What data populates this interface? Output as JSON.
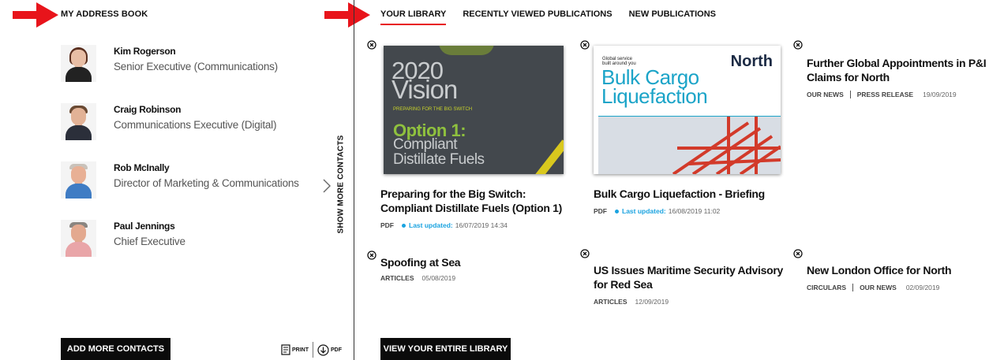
{
  "address_book": {
    "title": "MY ADDRESS BOOK",
    "contacts": [
      {
        "name": "Kim Rogerson",
        "role": "Senior Executive (Communications)"
      },
      {
        "name": "Craig Robinson",
        "role": "Communications Executive (Digital)"
      },
      {
        "name": "Rob McInally",
        "role": "Director of Marketing & Communications"
      },
      {
        "name": "Paul Jennings",
        "role": "Chief Executive"
      }
    ],
    "show_more": "SHOW MORE CONTACTS",
    "add_button": "ADD MORE CONTACTS",
    "print_label": "PRINT",
    "pdf_label": "PDF"
  },
  "library": {
    "tabs": [
      {
        "label": "YOUR LIBRARY",
        "active": true
      },
      {
        "label": "RECENTLY VIEWED PUBLICATIONS",
        "active": false
      },
      {
        "label": "NEW PUBLICATIONS",
        "active": false
      }
    ],
    "items": [
      {
        "title": "Preparing for the Big Switch: Compliant Distillate Fuels (Option 1)",
        "type": "PDF",
        "updated_label": "Last updated:",
        "updated": "16/07/2019 14:34"
      },
      {
        "title": "Bulk Cargo Liquefaction - Briefing",
        "type": "PDF",
        "updated_label": "Last updated:",
        "updated": "16/08/2019 11:02"
      },
      {
        "title": "Further Global Appointments in P&I Claims for North",
        "tags": [
          "OUR NEWS",
          "PRESS RELEASE"
        ],
        "date": "19/09/2019"
      },
      {
        "title": "Spoofing at Sea",
        "tags": [
          "ARTICLES"
        ],
        "date": "05/08/2019"
      },
      {
        "title": "US Issues Maritime Security Advisory for Red Sea",
        "tags": [
          "ARTICLES"
        ],
        "date": "12/09/2019"
      },
      {
        "title": "New London Office for North",
        "tags": [
          "CIRCULARS",
          "OUR NEWS"
        ],
        "date": "02/09/2019"
      }
    ],
    "view_all": "VIEW YOUR ENTIRE LIBRARY",
    "covers": {
      "vision": {
        "year": "2020",
        "word": "Vision",
        "subtitle": "PREPARING FOR THE BIG SWITCH",
        "option": "Option 1:",
        "line1": "Compliant",
        "line2": "Distillate Fuels"
      },
      "bulk": {
        "tag1": "Global service",
        "tag2": "built around you",
        "brand": "North",
        "line1": "Bulk Cargo",
        "line2": "Liquefaction"
      }
    }
  },
  "colors": {
    "accent": "#e8141b",
    "updated": "#1aa3e0",
    "button": "#0b0b0b"
  },
  "icons": [
    "arrow-right-icon",
    "close-circle-icon",
    "chevron-right-icon",
    "print-icon",
    "download-icon"
  ]
}
